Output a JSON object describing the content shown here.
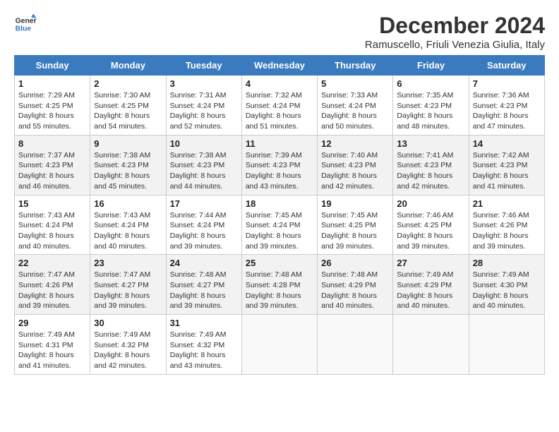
{
  "logo": {
    "line1": "General",
    "line2": "Blue"
  },
  "title": "December 2024",
  "subtitle": "Ramuscello, Friuli Venezia Giulia, Italy",
  "weekdays": [
    "Sunday",
    "Monday",
    "Tuesday",
    "Wednesday",
    "Thursday",
    "Friday",
    "Saturday"
  ],
  "weeks": [
    [
      {
        "day": "1",
        "sunrise": "Sunrise: 7:29 AM",
        "sunset": "Sunset: 4:25 PM",
        "daylight": "Daylight: 8 hours and 55 minutes."
      },
      {
        "day": "2",
        "sunrise": "Sunrise: 7:30 AM",
        "sunset": "Sunset: 4:25 PM",
        "daylight": "Daylight: 8 hours and 54 minutes."
      },
      {
        "day": "3",
        "sunrise": "Sunrise: 7:31 AM",
        "sunset": "Sunset: 4:24 PM",
        "daylight": "Daylight: 8 hours and 52 minutes."
      },
      {
        "day": "4",
        "sunrise": "Sunrise: 7:32 AM",
        "sunset": "Sunset: 4:24 PM",
        "daylight": "Daylight: 8 hours and 51 minutes."
      },
      {
        "day": "5",
        "sunrise": "Sunrise: 7:33 AM",
        "sunset": "Sunset: 4:24 PM",
        "daylight": "Daylight: 8 hours and 50 minutes."
      },
      {
        "day": "6",
        "sunrise": "Sunrise: 7:35 AM",
        "sunset": "Sunset: 4:23 PM",
        "daylight": "Daylight: 8 hours and 48 minutes."
      },
      {
        "day": "7",
        "sunrise": "Sunrise: 7:36 AM",
        "sunset": "Sunset: 4:23 PM",
        "daylight": "Daylight: 8 hours and 47 minutes."
      }
    ],
    [
      {
        "day": "8",
        "sunrise": "Sunrise: 7:37 AM",
        "sunset": "Sunset: 4:23 PM",
        "daylight": "Daylight: 8 hours and 46 minutes."
      },
      {
        "day": "9",
        "sunrise": "Sunrise: 7:38 AM",
        "sunset": "Sunset: 4:23 PM",
        "daylight": "Daylight: 8 hours and 45 minutes."
      },
      {
        "day": "10",
        "sunrise": "Sunrise: 7:38 AM",
        "sunset": "Sunset: 4:23 PM",
        "daylight": "Daylight: 8 hours and 44 minutes."
      },
      {
        "day": "11",
        "sunrise": "Sunrise: 7:39 AM",
        "sunset": "Sunset: 4:23 PM",
        "daylight": "Daylight: 8 hours and 43 minutes."
      },
      {
        "day": "12",
        "sunrise": "Sunrise: 7:40 AM",
        "sunset": "Sunset: 4:23 PM",
        "daylight": "Daylight: 8 hours and 42 minutes."
      },
      {
        "day": "13",
        "sunrise": "Sunrise: 7:41 AM",
        "sunset": "Sunset: 4:23 PM",
        "daylight": "Daylight: 8 hours and 42 minutes."
      },
      {
        "day": "14",
        "sunrise": "Sunrise: 7:42 AM",
        "sunset": "Sunset: 4:23 PM",
        "daylight": "Daylight: 8 hours and 41 minutes."
      }
    ],
    [
      {
        "day": "15",
        "sunrise": "Sunrise: 7:43 AM",
        "sunset": "Sunset: 4:24 PM",
        "daylight": "Daylight: 8 hours and 40 minutes."
      },
      {
        "day": "16",
        "sunrise": "Sunrise: 7:43 AM",
        "sunset": "Sunset: 4:24 PM",
        "daylight": "Daylight: 8 hours and 40 minutes."
      },
      {
        "day": "17",
        "sunrise": "Sunrise: 7:44 AM",
        "sunset": "Sunset: 4:24 PM",
        "daylight": "Daylight: 8 hours and 39 minutes."
      },
      {
        "day": "18",
        "sunrise": "Sunrise: 7:45 AM",
        "sunset": "Sunset: 4:24 PM",
        "daylight": "Daylight: 8 hours and 39 minutes."
      },
      {
        "day": "19",
        "sunrise": "Sunrise: 7:45 AM",
        "sunset": "Sunset: 4:25 PM",
        "daylight": "Daylight: 8 hours and 39 minutes."
      },
      {
        "day": "20",
        "sunrise": "Sunrise: 7:46 AM",
        "sunset": "Sunset: 4:25 PM",
        "daylight": "Daylight: 8 hours and 39 minutes."
      },
      {
        "day": "21",
        "sunrise": "Sunrise: 7:46 AM",
        "sunset": "Sunset: 4:26 PM",
        "daylight": "Daylight: 8 hours and 39 minutes."
      }
    ],
    [
      {
        "day": "22",
        "sunrise": "Sunrise: 7:47 AM",
        "sunset": "Sunset: 4:26 PM",
        "daylight": "Daylight: 8 hours and 39 minutes."
      },
      {
        "day": "23",
        "sunrise": "Sunrise: 7:47 AM",
        "sunset": "Sunset: 4:27 PM",
        "daylight": "Daylight: 8 hours and 39 minutes."
      },
      {
        "day": "24",
        "sunrise": "Sunrise: 7:48 AM",
        "sunset": "Sunset: 4:27 PM",
        "daylight": "Daylight: 8 hours and 39 minutes."
      },
      {
        "day": "25",
        "sunrise": "Sunrise: 7:48 AM",
        "sunset": "Sunset: 4:28 PM",
        "daylight": "Daylight: 8 hours and 39 minutes."
      },
      {
        "day": "26",
        "sunrise": "Sunrise: 7:48 AM",
        "sunset": "Sunset: 4:29 PM",
        "daylight": "Daylight: 8 hours and 40 minutes."
      },
      {
        "day": "27",
        "sunrise": "Sunrise: 7:49 AM",
        "sunset": "Sunset: 4:29 PM",
        "daylight": "Daylight: 8 hours and 40 minutes."
      },
      {
        "day": "28",
        "sunrise": "Sunrise: 7:49 AM",
        "sunset": "Sunset: 4:30 PM",
        "daylight": "Daylight: 8 hours and 40 minutes."
      }
    ],
    [
      {
        "day": "29",
        "sunrise": "Sunrise: 7:49 AM",
        "sunset": "Sunset: 4:31 PM",
        "daylight": "Daylight: 8 hours and 41 minutes."
      },
      {
        "day": "30",
        "sunrise": "Sunrise: 7:49 AM",
        "sunset": "Sunset: 4:32 PM",
        "daylight": "Daylight: 8 hours and 42 minutes."
      },
      {
        "day": "31",
        "sunrise": "Sunrise: 7:49 AM",
        "sunset": "Sunset: 4:32 PM",
        "daylight": "Daylight: 8 hours and 43 minutes."
      },
      null,
      null,
      null,
      null
    ]
  ]
}
